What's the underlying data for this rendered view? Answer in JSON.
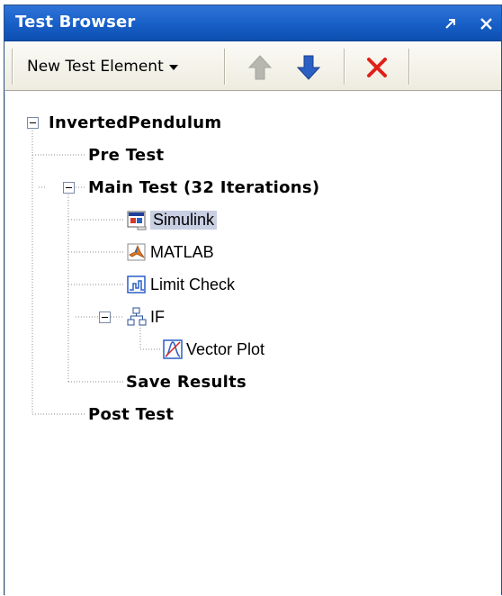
{
  "panel": {
    "title": "Test Browser",
    "pin_icon": "pin-icon",
    "close_icon": "close-icon"
  },
  "toolbar": {
    "new_element_label": "New Test Element",
    "move_up_icon": "arrow-up-icon",
    "move_down_icon": "arrow-down-icon",
    "delete_icon": "delete-x-icon"
  },
  "tree": {
    "root": "InvertedPendulum",
    "pre_test": "Pre Test",
    "main_test": "Main Test (32 Iterations)",
    "simulink": "Simulink",
    "matlab": "MATLAB",
    "limit_check": "Limit Check",
    "if_node": "IF",
    "vector_plot": "Vector Plot",
    "save_results": "Save Results",
    "post_test": "Post Test"
  },
  "colors": {
    "title_bar": "#175ec6",
    "selection": "#c9cfe3",
    "delete_red": "#e0201a",
    "arrow_blue": "#2a5fc4"
  }
}
